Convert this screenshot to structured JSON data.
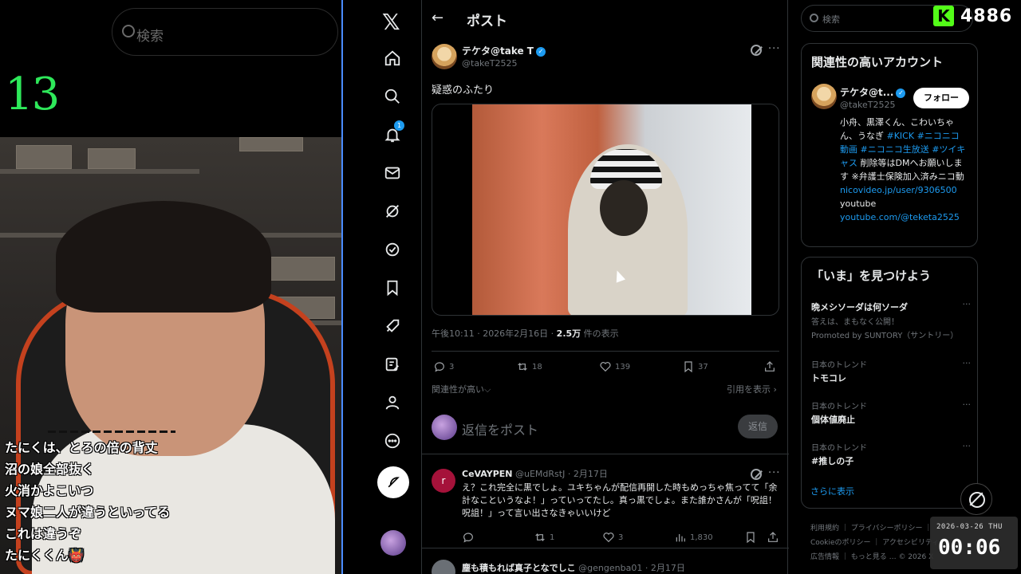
{
  "stream": {
    "ghost_search_placeholder": "検索",
    "counter": "13",
    "chat": [
      "たにくは、とろの倍の背丈",
      "沼の娘全部抜く",
      "火消かよこいつ",
      "ヌマ娘二人が違うといってる",
      "これは違うぞ",
      "たにくくん👹"
    ]
  },
  "kick": {
    "count": "4886",
    "logo": "K"
  },
  "clock": {
    "date": "2026-03-26 THU",
    "time": "00:06"
  },
  "nav": {
    "items": [
      "home-icon",
      "explore-icon",
      "notifications-icon",
      "messages-icon",
      "grok-icon",
      "verified-icon",
      "bookmarks-icon",
      "jobs-icon",
      "communities-icon",
      "profile-icon",
      "more-icon"
    ],
    "notif_count": "1"
  },
  "post": {
    "header_title": "ポスト",
    "author_name": "テケタ@take T",
    "author_handle": "@takeT2525",
    "text": "疑惑のふたり",
    "time": "午後10:11 · 2026年2月16日 · ",
    "views_count": "2.5万",
    "views_label": " 件の表示",
    "replies": "3",
    "reposts": "18",
    "likes": "139",
    "bookmarks": "37",
    "sort_label": "関連性が高い⌵",
    "quotes_label": "引用を表示 ›",
    "reply_placeholder": "返信をポスト",
    "reply_button": "返信"
  },
  "comment": {
    "avatar_letter": "r",
    "name": "CeVAYPEN",
    "meta": " @uEMdRstJ · 2月17日",
    "body": "え？これ完全に黒でしょ。ユキちゃんが配信再開した時もめっちゃ焦ってて「余計なこというなよ！」っていってたし。真っ黒でしょ。また誰かさんが「呪詛！呪詛！」って言い出さなきゃいいけど",
    "replies": "",
    "reposts": "1",
    "likes": "3",
    "views": "1,830"
  },
  "next_comment": {
    "name": "塵も積もれば真子となでしこ",
    "meta": " @gengenba01 · 2月17日"
  },
  "sidebar": {
    "search_placeholder": "検索",
    "related_title": "関連性の高いアカウント",
    "acct_name": "テケタ@t...",
    "acct_handle": "@takeT2525",
    "follow": "フォロー",
    "bio_text_1": "小舟、黒澤くん、こわいちゃん、うなぎ ",
    "bio_tag_1": "#KICK #ニコニコ動画 #ニコニコ生放送 #ツイキャス",
    "bio_text_2": " 削除等はDMへお願いします ※弁護士保険加入済みニコ動",
    "bio_link_1": "nicovideo.jp/user/9306500",
    "bio_text_3": "youtube",
    "bio_link_2": "youtube.com/@teketa2525",
    "trends_title": "「いま」を見つけよう",
    "trends": [
      {
        "cat": "",
        "name": "晩メシソーダは何ソーダ",
        "sub": "答えは、まもなく公開！",
        "promo": "Promoted by SUNTORY（サントリー）"
      },
      {
        "cat": "日本のトレンド",
        "name": "トモコレ",
        "sub": "",
        "promo": ""
      },
      {
        "cat": "日本のトレンド",
        "name": "個体値廃止",
        "sub": "",
        "promo": ""
      },
      {
        "cat": "日本のトレンド",
        "name": "#推しの子",
        "sub": "",
        "promo": ""
      }
    ],
    "show_more": "さらに表示",
    "footer_1": "利用規約 ｜ プライバシーポリシー ｜",
    "footer_2": "Cookieのポリシー ｜ アクセシビリティ",
    "footer_3": "広告情報 ｜ もっと見る … © 2026 X"
  }
}
